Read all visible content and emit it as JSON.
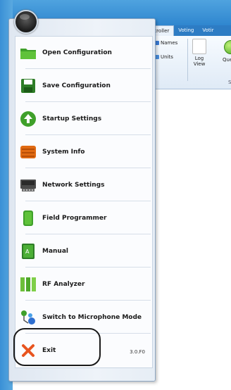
{
  "ribbon": {
    "tabs": [
      {
        "label": "ntroller",
        "active": true
      },
      {
        "label": "Voting",
        "active": false
      },
      {
        "label": "Votir",
        "active": false
      }
    ],
    "names_label": "Names",
    "units_label": "Units",
    "log_view_line1": "Log",
    "log_view_line2": "View",
    "partial_button_label": "Que",
    "partial_group_label": "S"
  },
  "menu": {
    "items": [
      {
        "label": "Open Configuration",
        "icon": "folder-icon"
      },
      {
        "label": "Save Configuration",
        "icon": "floppy-disk-icon"
      },
      {
        "label": "Startup Settings",
        "icon": "up-arrow-icon"
      },
      {
        "label": "System Info",
        "icon": "system-info-icon"
      },
      {
        "label": "Network Settings",
        "icon": "network-icon"
      },
      {
        "label": "Field Programmer",
        "icon": "field-programmer-icon"
      },
      {
        "label": "Manual",
        "icon": "manual-icon"
      },
      {
        "label": "RF Analyzer",
        "icon": "rf-analyzer-icon"
      },
      {
        "label": "Switch to Microphone Mode",
        "icon": "microphone-mode-icon"
      },
      {
        "label": "Exit",
        "icon": "close-x-icon"
      }
    ],
    "version": "3.0.F0"
  },
  "colors": {
    "title_bar": "#2f86cf",
    "menu_background": "#eef3f9",
    "exit_icon": "#e8541f",
    "green_icon": "#3fa02a"
  }
}
